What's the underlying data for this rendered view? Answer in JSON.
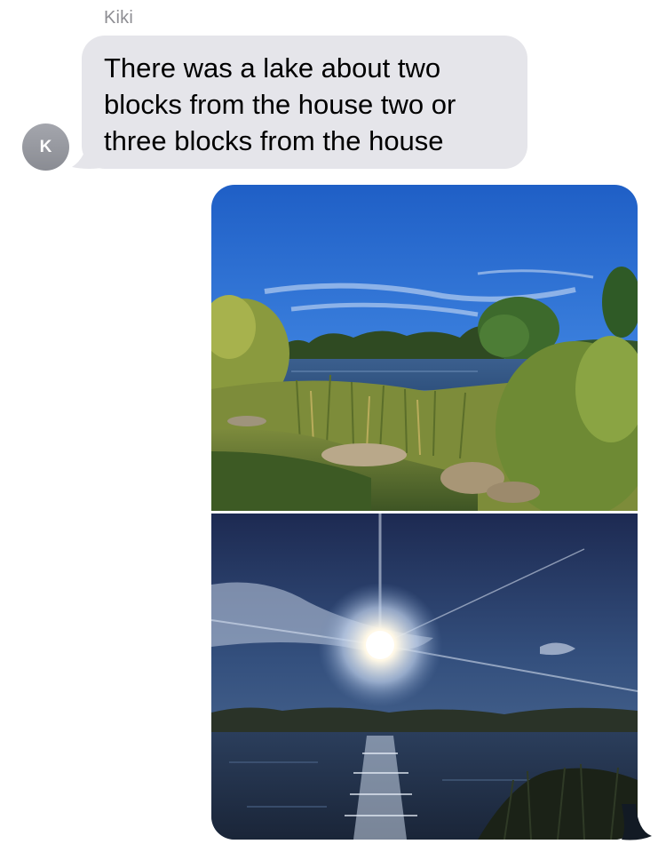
{
  "thread": {
    "sender_name": "Kiki",
    "avatar_initial": "K"
  },
  "messages": [
    {
      "type": "text",
      "text": "There was a lake about two blocks from the house two or three blocks from the house"
    },
    {
      "type": "photos",
      "photos": [
        "lake-daytime-photo",
        "lake-sunset-photo"
      ]
    }
  ],
  "colors": {
    "incoming_bubble": "#e5e5ea",
    "sender_name": "#8e8e93",
    "avatar": "#9a9ca3"
  },
  "icons": [
    "avatar"
  ]
}
